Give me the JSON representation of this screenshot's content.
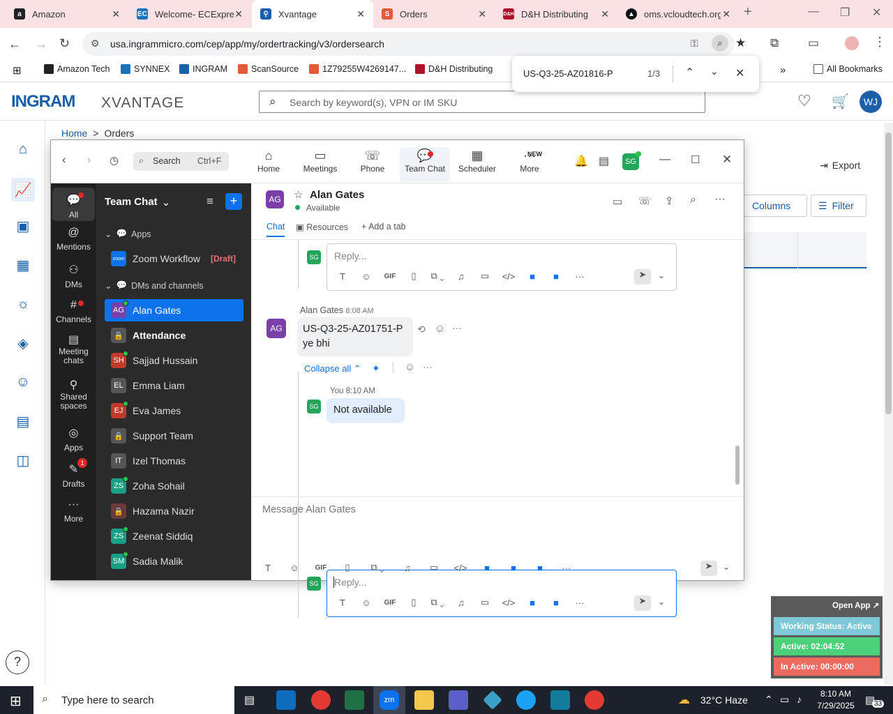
{
  "browser": {
    "tabs": [
      {
        "label": "Amazon",
        "icon": "amazon-icon"
      },
      {
        "label": "Welcome- ECExpre",
        "icon": "ec-icon"
      },
      {
        "label": "Xvantage",
        "icon": "ingram-icon",
        "active": true
      },
      {
        "label": "Orders",
        "icon": "scansource-icon"
      },
      {
        "label": "D&H Distributing",
        "icon": "dh-icon"
      },
      {
        "label": "oms.vcloudtech.org",
        "icon": "vcloud-icon"
      }
    ],
    "url": "usa.ingrammicro.com/cep/app/my/ordertracking/v3/ordersearch",
    "bookmarks": [
      "Amazon Tech",
      "SYNNEX",
      "INGRAM",
      "ScanSource",
      "1Z79255W4269147...",
      "D&H Distributing"
    ],
    "all_bookmarks": "All Bookmarks",
    "find": {
      "query": "US-Q3-25-AZ01816-P",
      "count": "1/3"
    }
  },
  "ingram": {
    "logo": "INGRAM",
    "logo_sub": "XVANTAGE",
    "search_placeholder": "Search by keyword(s), VPN or IM SKU",
    "user_initials": "WJ",
    "breadcrumb_home": "Home",
    "breadcrumb_sep": ">",
    "breadcrumb_current": "Orders",
    "export_label": "Export",
    "columns_label": "Columns",
    "filter_label": "Filter"
  },
  "zoom": {
    "search_label": "Search",
    "search_shortcut": "Ctrl+F",
    "nav": [
      {
        "label": "Home"
      },
      {
        "label": "Meetings"
      },
      {
        "label": "Phone"
      },
      {
        "label": "Team Chat"
      },
      {
        "label": "Scheduler"
      },
      {
        "label": "More",
        "badge": "NEW"
      }
    ],
    "self_initials": "SG",
    "rail": [
      {
        "label": "All"
      },
      {
        "label": "Mentions"
      },
      {
        "label": "DMs"
      },
      {
        "label": "Channels"
      },
      {
        "label": "Meeting chats"
      },
      {
        "label": "Shared spaces"
      },
      {
        "label": "Apps"
      },
      {
        "label": "Drafts",
        "badge": "1"
      },
      {
        "label": "More"
      }
    ],
    "sidebar": {
      "title": "Team Chat",
      "apps_heading": "Apps",
      "apps": [
        {
          "name": "Zoom Workflow",
          "tag": "[Draft]",
          "initials": "zoom"
        }
      ],
      "dms_heading": "DMs and channels",
      "contacts": [
        {
          "name": "Alan Gates",
          "initials": "AG",
          "color": "#7a3fa8",
          "selected": true
        },
        {
          "name": "Attendance",
          "initials": "",
          "color": "#555555",
          "bold": true
        },
        {
          "name": "Sajjad Hussain",
          "initials": "SH",
          "color": "#c0392b"
        },
        {
          "name": "Emma Liam",
          "initials": "EL",
          "color": "#555555"
        },
        {
          "name": "Eva James",
          "initials": "EJ",
          "color": "#c0392b"
        },
        {
          "name": "Support Team",
          "initials": "",
          "color": "#555555"
        },
        {
          "name": "Izel Thomas",
          "initials": "IT",
          "color": "#555555"
        },
        {
          "name": "Zoha Sohail",
          "initials": "ZS",
          "color": "#17a086"
        },
        {
          "name": "Hazama Nazir",
          "initials": "",
          "color": "#6b3a3a"
        },
        {
          "name": "Zeenat Siddiq",
          "initials": "ZS",
          "color": "#17a086"
        },
        {
          "name": "Sadia Malik",
          "initials": "SM",
          "color": "#17a086"
        }
      ]
    },
    "chat": {
      "contact_name": "Alan Gates",
      "contact_initials": "AG",
      "contact_status": "Available",
      "tabs": [
        "Chat",
        "Resources",
        "Add a tab"
      ],
      "reply_placeholder": "Reply...",
      "message_sender": "Alan Gates",
      "message_time": "8:08 AM",
      "message_line1": "US-Q3-25-AZ01751-P",
      "message_line2": "ye bhi",
      "collapse_label": "Collapse all",
      "reply_sender": "You",
      "reply_time": "8:10 AM",
      "reply_text": "Not available",
      "compose_placeholder": "Message Alan Gates",
      "gif_label": "GIF"
    }
  },
  "widget": {
    "open_app": "Open App ↗",
    "working_status": "Working Status: Active",
    "active": "Active: 02:04:52",
    "inactive": "In Active: 00:00:00"
  },
  "taskbar": {
    "search_placeholder": "Type here to search",
    "weather": "32°C  Haze",
    "time": "8:10 AM",
    "date": "7/29/2025",
    "notifications": "33"
  }
}
